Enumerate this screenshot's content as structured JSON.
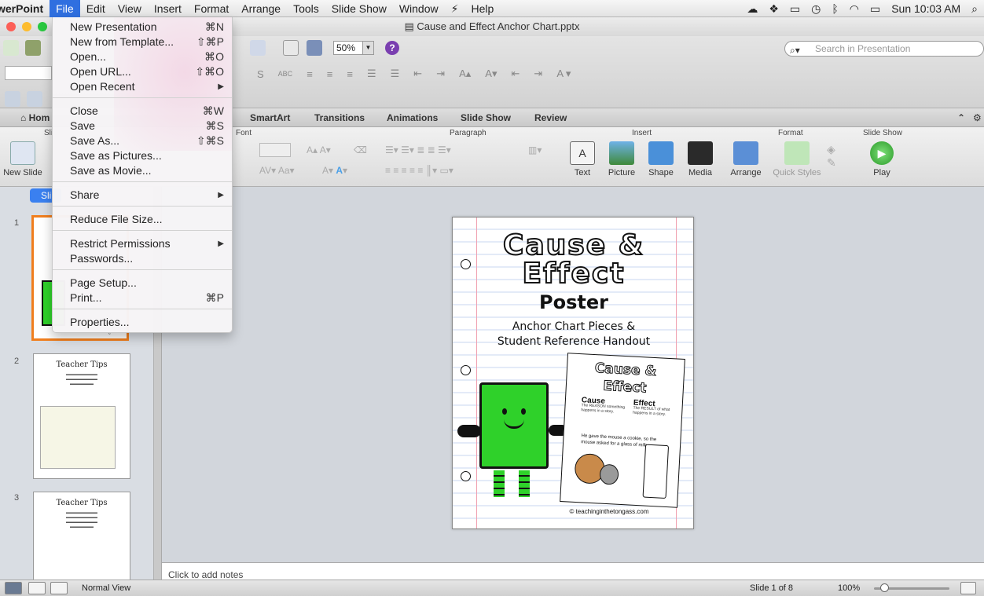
{
  "menubar": {
    "app": "werPoint",
    "menus": [
      "File",
      "Edit",
      "View",
      "Insert",
      "Format",
      "Arrange",
      "Tools",
      "Slide Show",
      "Window",
      "Help"
    ],
    "clock": "Sun 10:03 AM"
  },
  "window": {
    "title": "Cause and Effect Anchor Chart.pptx"
  },
  "toolbar": {
    "zoom": "50%",
    "search_placeholder": "Search in Presentation"
  },
  "ribbon": {
    "tabs": [
      "Hom",
      "SmartArt",
      "Transitions",
      "Animations",
      "Slide Show",
      "Review"
    ],
    "groups": {
      "font": "Font",
      "paragraph": "Paragraph",
      "insert": "Insert",
      "format": "Format",
      "slideshow": "Slide Show",
      "slides": "Sli"
    },
    "buttons": {
      "new_slide": "New Slide",
      "text": "Text",
      "picture": "Picture",
      "shape": "Shape",
      "media": "Media",
      "arrange": "Arrange",
      "quick_styles": "Quick Styles",
      "play": "Play"
    }
  },
  "file_menu": {
    "items": [
      {
        "label": "New Presentation",
        "shortcut": "⌘N"
      },
      {
        "label": "New from Template...",
        "shortcut": "⇧⌘P"
      },
      {
        "label": "Open...",
        "shortcut": "⌘O"
      },
      {
        "label": "Open URL...",
        "shortcut": "⇧⌘O"
      },
      {
        "label": "Open Recent",
        "shortcut": ""
      },
      {
        "label": "Close",
        "shortcut": "⌘W"
      },
      {
        "label": "Save",
        "shortcut": "⌘S"
      },
      {
        "label": "Save As...",
        "shortcut": "⇧⌘S"
      },
      {
        "label": "Save as Pictures...",
        "shortcut": ""
      },
      {
        "label": "Save as Movie...",
        "shortcut": ""
      },
      {
        "label": "Share",
        "shortcut": ""
      },
      {
        "label": "Reduce File Size...",
        "shortcut": ""
      },
      {
        "label": "Restrict Permissions",
        "shortcut": ""
      },
      {
        "label": "Passwords...",
        "shortcut": ""
      },
      {
        "label": "Page Setup...",
        "shortcut": ""
      },
      {
        "label": "Print...",
        "shortcut": "⌘P"
      },
      {
        "label": "Properties...",
        "shortcut": ""
      }
    ]
  },
  "slides_pane": {
    "tab": "Sli",
    "numbers": [
      "1",
      "2",
      "3"
    ],
    "thumb_titles": [
      "",
      "Teacher Tips",
      "Teacher Tips"
    ]
  },
  "slide": {
    "title_line1": "Cause &",
    "title_line2": "Effect",
    "poster": "Poster",
    "subtitle_line1": "Anchor Chart Pieces &",
    "subtitle_line2": "Student Reference Handout",
    "handout_title1": "Cause &",
    "handout_title2": "Effect",
    "handout_cause": "Cause",
    "handout_cause_def": "The REASON something happens in a story.",
    "handout_effect": "Effect",
    "handout_effect_def": "The RESULT of what happens in a story.",
    "handout_example": "He gave the mouse a cookie, so the mouse asked for a glass of milk.",
    "copyright": "© teachinginthetongass.com"
  },
  "notes": {
    "placeholder": "Click to add notes"
  },
  "status": {
    "view": "Normal View",
    "slide_count": "Slide 1 of 8",
    "zoom": "100%"
  }
}
